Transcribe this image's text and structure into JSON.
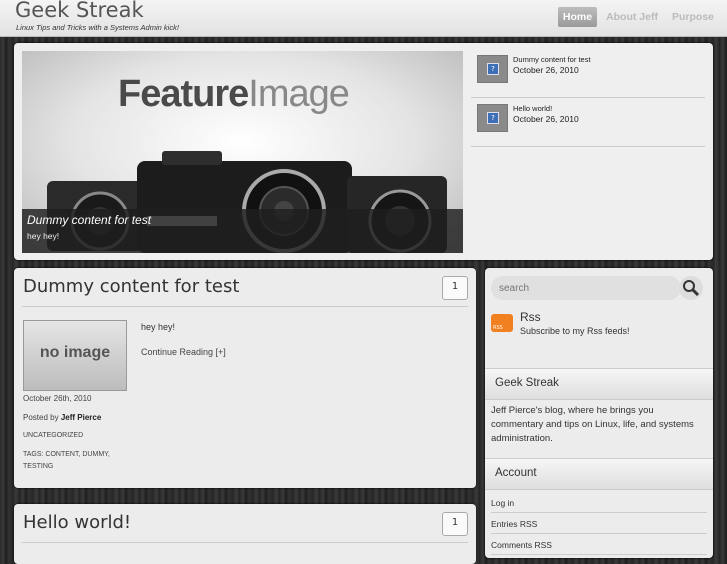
{
  "header": {
    "site_title": "Geek Streak",
    "tagline": "Linux Tips and Tricks with a Systems Admin kick!",
    "nav": [
      {
        "label": "Home",
        "active": true
      },
      {
        "label": "About Jeff",
        "active": false
      },
      {
        "label": "Purpose",
        "active": false
      }
    ]
  },
  "feature": {
    "image_text_bold": "Feature",
    "image_text_light": "Image",
    "caption_title": "Dummy content for test",
    "caption_sub": "hey hey!",
    "thumbs": [
      {
        "title": "Dummy content for test",
        "date": "October 26, 2010"
      },
      {
        "title": "Hello world!",
        "date": "October 26, 2010"
      }
    ]
  },
  "posts": [
    {
      "title": "Dummy content for test",
      "comments": "1",
      "image_label": "no image",
      "excerpt": "hey hey!",
      "read_more": "Continue Reading [+]",
      "date": "October 26th, 2010",
      "posted_by_prefix": "Posted by",
      "author": "Jeff Pierce",
      "category": "UNCATEGORIZED",
      "tags_line1": "TAGS: CONTENT, DUMMY,",
      "tags_line2": "TESTING"
    },
    {
      "title": "Hello world!",
      "comments": "1"
    }
  ],
  "sidebar": {
    "search_placeholder": "search",
    "rss_title": "Rss",
    "rss_sub": "Subscribe to my Rss feeds!",
    "rss_icon_text": "RSS",
    "widget1_title": "Geek Streak",
    "widget1_text": "Jeff Pierce's blog, where he brings you commentary and tips on Linux, life, and systems administration.",
    "widget2_title": "Account",
    "links": [
      "Log in",
      "Entries RSS",
      "Comments RSS"
    ]
  }
}
